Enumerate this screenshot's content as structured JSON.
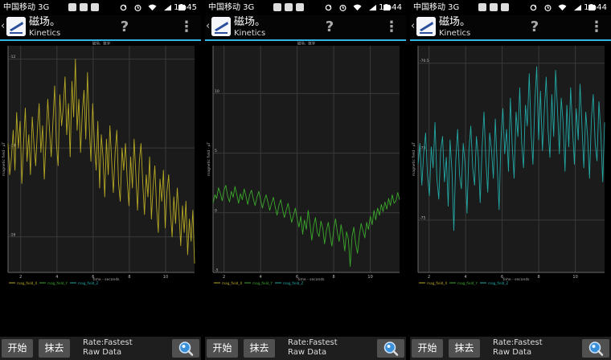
{
  "screens": [
    {
      "status": {
        "carrier": "中国移动 3G",
        "time": "13:45"
      },
      "app": {
        "title": "磁场。",
        "subtitle": "Kinetics"
      },
      "menu": {
        "help": "?",
        "more": "⋮"
      },
      "buttons": {
        "start": "开始",
        "erase": "抹去"
      },
      "rate_text": "Rate:Fastest",
      "data_text": "Raw Data",
      "chart_data": {
        "type": "line",
        "title": "磁场、数字",
        "xlabel": "time - seconds",
        "ylabel": "magnetic field - µT",
        "xlim": [
          1.3,
          11.6
        ],
        "ylim": [
          -16.8,
          -11.7
        ],
        "x_ticks": [
          "2",
          "4",
          "6",
          "8",
          "10"
        ],
        "y_ticks": [
          "-12",
          "-14",
          "-16"
        ],
        "grid": true,
        "legend": [
          "mag_field_X",
          "mag_field_Y",
          "mag_field_Z"
        ],
        "legend_colors": [
          "#b5a824",
          "#3aa82a",
          "#22a7a3"
        ],
        "series": [
          {
            "name": "mag_field_X",
            "color": "#b5a824",
            "values": [
              -13.9,
              -14.6,
              -14.2,
              -13.6,
              -14.5,
              -13.2,
              -14.0,
              -13.4,
              -14.8,
              -13.9,
              -13.1,
              -14.3,
              -13.7,
              -14.6,
              -13.3,
              -13.9,
              -14.4,
              -13.6,
              -13.0,
              -14.1,
              -13.5,
              -14.7,
              -13.8,
              -12.9,
              -13.6,
              -14.2,
              -13.4,
              -12.6,
              -13.9,
              -14.4,
              -12.8,
              -13.5,
              -13.1,
              -12.4,
              -13.7,
              -13.0,
              -14.2,
              -12.5,
              -13.3,
              -12.0,
              -13.6,
              -12.9,
              -14.1,
              -13.2,
              -12.7,
              -13.8,
              -12.3,
              -13.5,
              -14.3,
              -13.0,
              -13.9,
              -14.5,
              -13.4,
              -14.9,
              -13.7,
              -14.2,
              -15.1,
              -13.8,
              -14.6,
              -13.5,
              -14.3,
              -15.0,
              -14.1,
              -13.6,
              -14.8,
              -15.2,
              -14.0,
              -14.5,
              -13.9,
              -14.7,
              -15.3,
              -14.2,
              -14.9,
              -13.8,
              -14.6,
              -15.4,
              -14.3,
              -13.9,
              -14.8,
              -15.5,
              -14.6,
              -15.1,
              -14.2,
              -15.6,
              -14.9,
              -14.4,
              -15.3,
              -15.9,
              -14.7,
              -15.2,
              -14.5,
              -15.8,
              -15.0,
              -14.6,
              -15.4,
              -16.0,
              -15.1,
              -15.7,
              -14.9,
              -15.5,
              -16.2,
              -15.3,
              -15.9,
              -15.2,
              -16.4,
              -15.6,
              -16.1,
              -15.4,
              -16.6
            ]
          }
        ]
      }
    },
    {
      "status": {
        "carrier": "中国移动 3G",
        "time": "13:44"
      },
      "app": {
        "title": "磁场。",
        "subtitle": "Kinetics"
      },
      "menu": {
        "help": "?",
        "more": "⋮"
      },
      "buttons": {
        "start": "开始",
        "erase": "抹去"
      },
      "rate_text": "Rate:Fastest",
      "data_text": "Raw Data",
      "chart_data": {
        "type": "line",
        "title": "磁场、数字",
        "xlabel": "time - seconds",
        "ylabel": "magnetic field - µT",
        "xlim": [
          1.4,
          11.6
        ],
        "ylim": [
          -5.0,
          14.0
        ],
        "x_ticks": [
          "2",
          "4",
          "6",
          "8",
          "10"
        ],
        "y_ticks": [
          "10",
          "5",
          "0",
          "-5"
        ],
        "grid": true,
        "legend": [
          "mag_field_X",
          "mag_field_Y",
          "mag_field_Z"
        ],
        "legend_colors": [
          "#b5a824",
          "#3aa82a",
          "#22a7a3"
        ],
        "series": [
          {
            "name": "mag_field_Y",
            "color": "#3aa82a",
            "values": [
              0.8,
              1.5,
              1.2,
              2.1,
              1.6,
              1.0,
              1.9,
              2.3,
              1.4,
              0.9,
              1.8,
              1.3,
              2.2,
              1.5,
              0.8,
              1.6,
              1.1,
              2.0,
              1.4,
              0.7,
              1.5,
              1.9,
              1.2,
              0.6,
              1.3,
              1.8,
              1.1,
              0.4,
              1.0,
              1.5,
              0.9,
              0.2,
              0.8,
              1.3,
              0.5,
              -0.2,
              0.6,
              1.1,
              0.3,
              -0.4,
              0.2,
              0.8,
              0.0,
              -0.8,
              -0.2,
              0.4,
              -0.5,
              -1.2,
              -0.3,
              -1.8,
              -0.6,
              -1.4,
              0.2,
              -0.9,
              -2.3,
              -1.1,
              -0.4,
              -1.6,
              -2.0,
              -0.7,
              -1.3,
              -2.6,
              -1.5,
              -0.8,
              -1.9,
              -2.8,
              -1.4,
              -0.5,
              -1.7,
              -2.4,
              -1.0,
              -1.8,
              -3.2,
              -1.6,
              -2.2,
              -4.5,
              -2.0,
              -1.2,
              -2.6,
              -3.4,
              -1.9,
              -0.9,
              -1.5,
              -2.1,
              -0.8,
              -1.4,
              -0.3,
              -1.0,
              0.2,
              -0.6,
              0.4,
              -0.2,
              0.7,
              0.1,
              0.9,
              0.3,
              1.2,
              0.6,
              1.5,
              0.8,
              1.0,
              1.7,
              1.1
            ]
          }
        ]
      }
    },
    {
      "status": {
        "carrier": "中国移动 3G",
        "time": "13:44"
      },
      "app": {
        "title": "磁场。",
        "subtitle": "Kinetics"
      },
      "menu": {
        "help": "?",
        "more": "⋮"
      },
      "buttons": {
        "start": "开始",
        "erase": "抹去"
      },
      "rate_text": "Rate:Fastest",
      "data_text": "Raw Data",
      "chart_data": {
        "type": "line",
        "title": "",
        "xlabel": "time - seconds",
        "ylabel": "magnetic field - µT",
        "xlim": [
          1.4,
          11.6
        ],
        "ylim": [
          -76.5,
          -70.0
        ],
        "x_ticks": [
          "2",
          "4",
          "6",
          "8",
          "10"
        ],
        "y_ticks": [
          "-70.5",
          "-73",
          "-75"
        ],
        "grid": true,
        "legend": [
          "mag_field_X",
          "mag_field_Y",
          "mag_field_Z"
        ],
        "legend_colors": [
          "#b5a824",
          "#3aa82a",
          "#22a7a3"
        ],
        "series": [
          {
            "name": "mag_field_Z",
            "color": "#22a7a3",
            "values": [
              -73.4,
              -72.8,
              -74.0,
              -73.1,
              -72.5,
              -73.7,
              -74.3,
              -72.9,
              -73.5,
              -72.2,
              -73.8,
              -74.4,
              -73.0,
              -72.6,
              -73.9,
              -73.2,
              -74.6,
              -72.7,
              -73.6,
              -75.3,
              -73.3,
              -72.4,
              -73.7,
              -74.1,
              -72.8,
              -73.4,
              -74.8,
              -73.0,
              -72.3,
              -73.5,
              -74.0,
              -72.6,
              -73.2,
              -74.5,
              -72.9,
              -71.9,
              -73.3,
              -74.2,
              -72.5,
              -73.0,
              -73.8,
              -72.1,
              -73.4,
              -74.7,
              -72.7,
              -71.8,
              -73.1,
              -72.4,
              -73.6,
              -71.5,
              -72.9,
              -73.8,
              -71.9,
              -72.6,
              -71.2,
              -72.8,
              -73.5,
              -71.7,
              -72.3,
              -70.8,
              -72.5,
              -73.4,
              -71.6,
              -70.6,
              -72.7,
              -71.3,
              -73.0,
              -71.9,
              -70.9,
              -72.4,
              -73.2,
              -71.4,
              -72.6,
              -70.7,
              -71.8,
              -73.1,
              -71.5,
              -72.2,
              -73.6,
              -71.7,
              -72.9,
              -71.2,
              -72.4,
              -73.4,
              -71.8,
              -72.7,
              -71.1,
              -72.3,
              -73.5,
              -71.9,
              -72.6,
              -73.8,
              -72.1,
              -71.4,
              -72.8,
              -73.3,
              -71.6,
              -72.5,
              -73.9,
              -72.2
            ]
          }
        ]
      }
    }
  ]
}
